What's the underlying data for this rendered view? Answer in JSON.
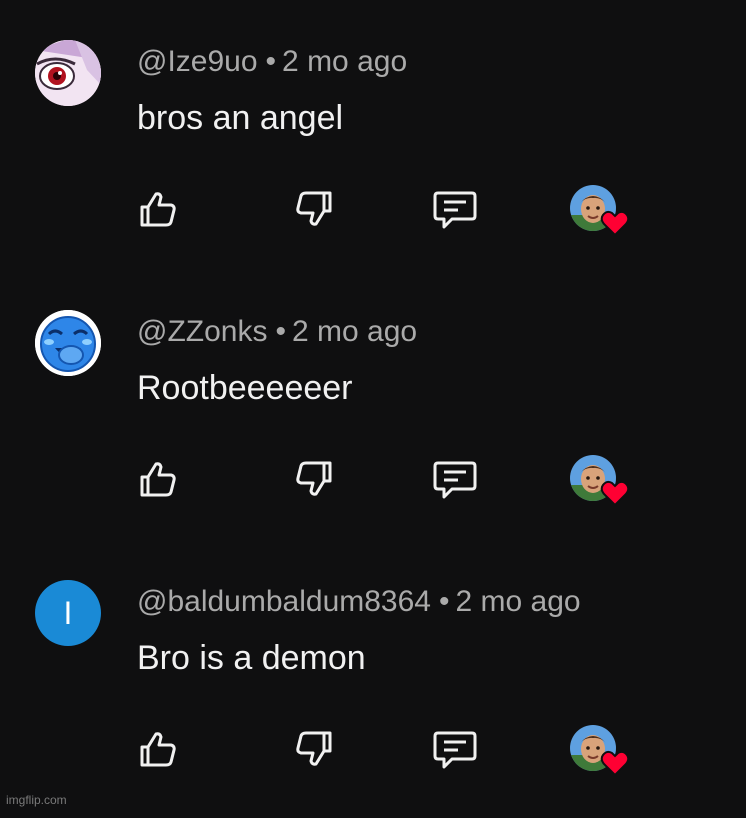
{
  "comments": [
    {
      "author": "@Ize9uo",
      "separator": "•",
      "age": "2 mo ago",
      "text": "bros an angel",
      "avatar_icon": "anime-eye-avatar"
    },
    {
      "author": "@ZZonks",
      "separator": "•",
      "age": "2 mo ago",
      "text": "Rootbeeeeeer",
      "avatar_icon": "laughing-emoji-avatar"
    },
    {
      "author": "@baldumbaldum8364",
      "separator": "•",
      "age": "2 mo ago",
      "text": "Bro is a demon",
      "avatar_letter": "I",
      "avatar_color": "#1a8ad6"
    }
  ],
  "icons": {
    "like": "thumbs-up-icon",
    "dislike": "thumbs-down-icon",
    "reply": "reply-icon",
    "creator_heart": "creator-heart-icon"
  },
  "colors": {
    "background": "#0f0f10",
    "meta_text": "#aaaaaa",
    "body_text": "#f1f1f1",
    "heart": "#ff0033"
  },
  "watermark": "imgflip.com"
}
